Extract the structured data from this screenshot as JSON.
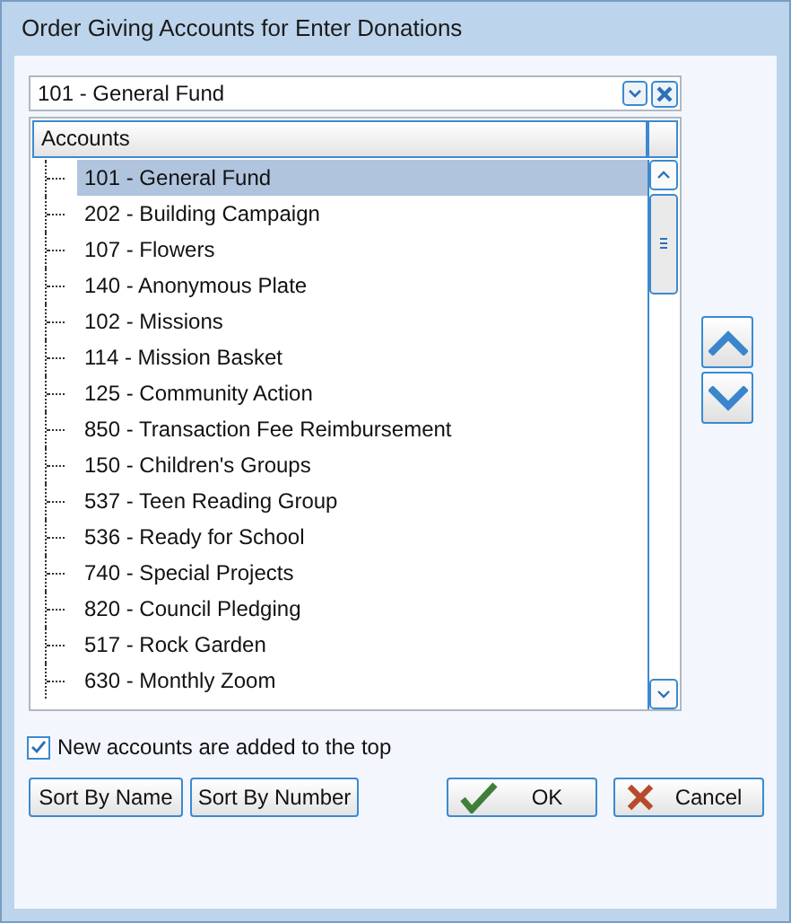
{
  "window": {
    "title": "Order Giving Accounts for Enter Donations"
  },
  "combo": {
    "value": "101 - General Fund"
  },
  "tree": {
    "column": "Accounts",
    "items": [
      {
        "label": "101 - General Fund",
        "selected": true
      },
      {
        "label": "202 - Building Campaign",
        "selected": false
      },
      {
        "label": "107 - Flowers",
        "selected": false
      },
      {
        "label": "140 - Anonymous Plate",
        "selected": false
      },
      {
        "label": "102 - Missions",
        "selected": false
      },
      {
        "label": "114 - Mission Basket",
        "selected": false
      },
      {
        "label": "125 - Community Action",
        "selected": false
      },
      {
        "label": "850 - Transaction Fee Reimbursement",
        "selected": false
      },
      {
        "label": "150 - Children's Groups",
        "selected": false
      },
      {
        "label": "537 - Teen Reading Group",
        "selected": false
      },
      {
        "label": "536 - Ready for School",
        "selected": false
      },
      {
        "label": "740 - Special Projects",
        "selected": false
      },
      {
        "label": "820 - Council Pledging",
        "selected": false
      },
      {
        "label": "517 - Rock Garden",
        "selected": false
      },
      {
        "label": "630 - Monthly Zoom",
        "selected": false
      }
    ]
  },
  "checkbox": {
    "label": "New accounts are added to the top",
    "checked": true
  },
  "buttons": [
    {
      "label": "Sort By Name",
      "kind": "plain"
    },
    {
      "label": "Sort By Number",
      "kind": "plain"
    },
    {
      "label": "OK",
      "kind": "ok"
    },
    {
      "label": "Cancel",
      "kind": "cancel"
    }
  ]
}
